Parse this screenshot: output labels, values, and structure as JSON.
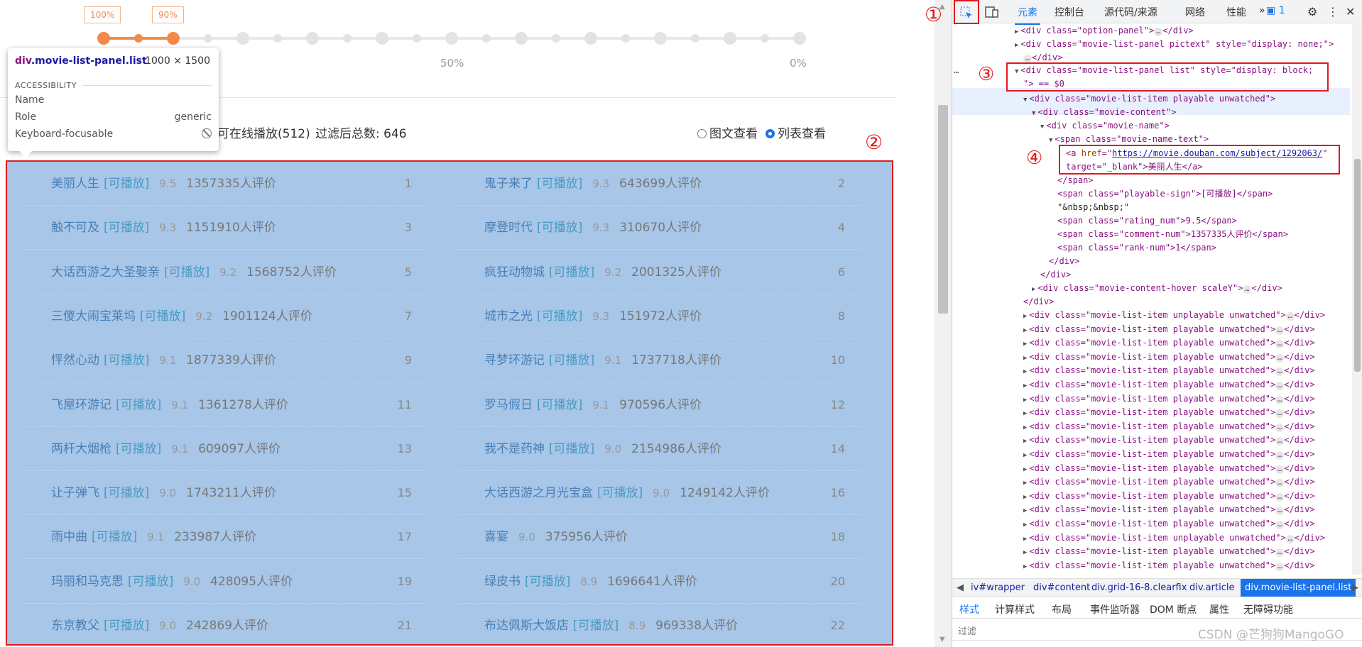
{
  "slider": {
    "labels": [
      "100%",
      "90%"
    ],
    "scale": [
      "50%",
      "0%"
    ]
  },
  "filter": {
    "online_play": "可在线播放(512)",
    "total": "过滤后总数: 646"
  },
  "view": {
    "pic": "图文查看",
    "list": "列表查看"
  },
  "tooltip": {
    "tag": "div",
    "class": ".movie-list-panel.list",
    "size": "1000 × 1500",
    "section": "ACCESSIBILITY",
    "name_label": "Name",
    "role_label": "Role",
    "role_value": "generic",
    "kb_label": "Keyboard-focusable"
  },
  "annotations": {
    "one": "①",
    "two": "②",
    "three": "③",
    "four": "④"
  },
  "movies": [
    {
      "name": "美丽人生",
      "play": "[可播放]",
      "rating": "9.5",
      "comments": "1357335人评价",
      "rank": "1"
    },
    {
      "name": "鬼子来了",
      "play": "[可播放]",
      "rating": "9.3",
      "comments": "643699人评价",
      "rank": "2"
    },
    {
      "name": "触不可及",
      "play": "[可播放]",
      "rating": "9.3",
      "comments": "1151910人评价",
      "rank": "3"
    },
    {
      "name": "摩登时代",
      "play": "[可播放]",
      "rating": "9.3",
      "comments": "310670人评价",
      "rank": "4"
    },
    {
      "name": "大话西游之大圣娶亲",
      "play": "[可播放]",
      "rating": "9.2",
      "comments": "1568752人评价",
      "rank": "5"
    },
    {
      "name": "疯狂动物城",
      "play": "[可播放]",
      "rating": "9.2",
      "comments": "2001325人评价",
      "rank": "6"
    },
    {
      "name": "三傻大闹宝莱坞",
      "play": "[可播放]",
      "rating": "9.2",
      "comments": "1901124人评价",
      "rank": "7"
    },
    {
      "name": "城市之光",
      "play": "[可播放]",
      "rating": "9.3",
      "comments": "151972人评价",
      "rank": "8"
    },
    {
      "name": "怦然心动",
      "play": "[可播放]",
      "rating": "9.1",
      "comments": "1877339人评价",
      "rank": "9"
    },
    {
      "name": "寻梦环游记",
      "play": "[可播放]",
      "rating": "9.1",
      "comments": "1737718人评价",
      "rank": "10"
    },
    {
      "name": "飞屋环游记",
      "play": "[可播放]",
      "rating": "9.1",
      "comments": "1361278人评价",
      "rank": "11"
    },
    {
      "name": "罗马假日",
      "play": "[可播放]",
      "rating": "9.1",
      "comments": "970596人评价",
      "rank": "12"
    },
    {
      "name": "两杆大烟枪",
      "play": "[可播放]",
      "rating": "9.1",
      "comments": "609097人评价",
      "rank": "13"
    },
    {
      "name": "我不是药神",
      "play": "[可播放]",
      "rating": "9.0",
      "comments": "2154986人评价",
      "rank": "14"
    },
    {
      "name": "让子弹飞",
      "play": "[可播放]",
      "rating": "9.0",
      "comments": "1743211人评价",
      "rank": "15"
    },
    {
      "name": "大话西游之月光宝盒",
      "play": "[可播放]",
      "rating": "9.0",
      "comments": "1249142人评价",
      "rank": "16"
    },
    {
      "name": "雨中曲",
      "play": "[可播放]",
      "rating": "9.1",
      "comments": "233987人评价",
      "rank": "17"
    },
    {
      "name": "喜宴",
      "play": "",
      "rating": "9.0",
      "comments": "375956人评价",
      "rank": "18"
    },
    {
      "name": "玛丽和马克思",
      "play": "[可播放]",
      "rating": "9.0",
      "comments": "428095人评价",
      "rank": "19"
    },
    {
      "name": "绿皮书",
      "play": "[可播放]",
      "rating": "8.9",
      "comments": "1696641人评价",
      "rank": "20"
    },
    {
      "name": "东京教父",
      "play": "[可播放]",
      "rating": "9.0",
      "comments": "242869人评价",
      "rank": "21"
    },
    {
      "name": "布达佩斯大饭店",
      "play": "[可播放]",
      "rating": "8.9",
      "comments": "969338人评价",
      "rank": "22"
    }
  ],
  "devtools": {
    "tabs": [
      "元素",
      "控制台",
      "源代码/来源",
      "网络",
      "性能"
    ],
    "more": "»",
    "msg_count": "1",
    "breadcrumbs": [
      "iv#wrapper",
      "div#content",
      "div.grid-16-8.clearfix",
      "div.article",
      "div.movie-list-panel.list"
    ],
    "style_tabs": [
      "样式",
      "计算样式",
      "布局",
      "事件监听器",
      "DOM 断点",
      "属性",
      "无障碍功能"
    ],
    "filter_placeholder": "过滤",
    "dom": {
      "l1": "<div class=\"option-panel\">",
      "l2": "<div class=\"movie-list-panel pictext\" style=\"display: none;\">",
      "l4": "<div class=\"movie-list-panel list\" style=\"display: block;",
      "l5": "\"> == $0",
      "l6": "<div class=\"movie-list-item playable unwatched\">",
      "l7": "<div class=\"movie-content\">",
      "l8": "<div class=\"movie-name\">",
      "l9": "<span class=\"movie-name-text\">",
      "href": "https://movie.douban.com/subject/1292063/",
      "target": "target=\"_blank\">美丽人生</a>",
      "l12": "</span>",
      "l13": "<span class=\"playable-sign\">[可播放]</span>",
      "l14": "\"&nbsp;&nbsp;\"",
      "l15": "<span class=\"rating_num\">9.5</span>",
      "l16": "<span class=\"comment-num\">1357335人评价</span>",
      "l17": "<span class=\"rank-num\">1</span>",
      "l18": "</div>",
      "l19": "</div>",
      "l20": "<div class=\"movie-content-hover scaleY\">",
      "l21": "</div>",
      "unplayable": "<div class=\"movie-list-item unplayable unwatched\">",
      "playable": "<div class=\"movie-list-item playable unwatched\">",
      "close": "</div>"
    }
  },
  "watermark": "CSDN @芒狗狗MangoGO"
}
